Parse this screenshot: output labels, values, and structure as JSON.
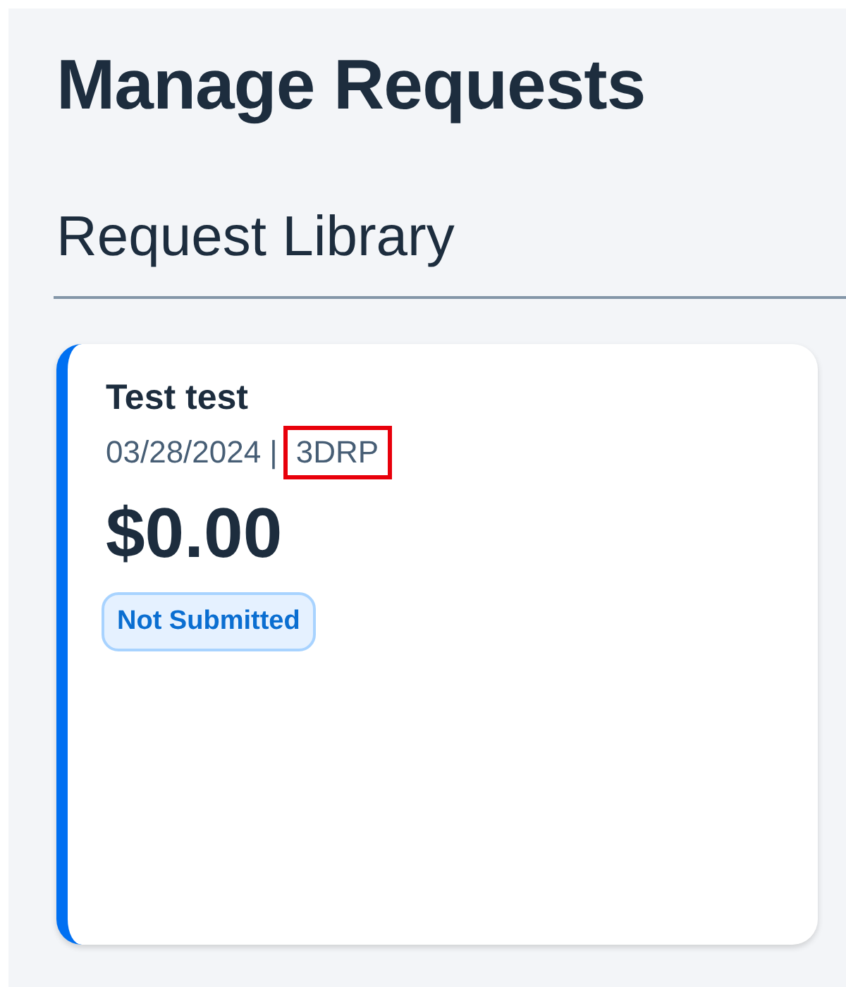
{
  "page": {
    "title": "Manage Requests"
  },
  "section": {
    "title": "Request Library"
  },
  "cards": [
    {
      "name": "Test test",
      "date": "03/28/2024",
      "separator": "|",
      "code": "3DRP",
      "code_highlighted": true,
      "amount": "$0.00",
      "status": "Not Submitted"
    }
  ]
}
